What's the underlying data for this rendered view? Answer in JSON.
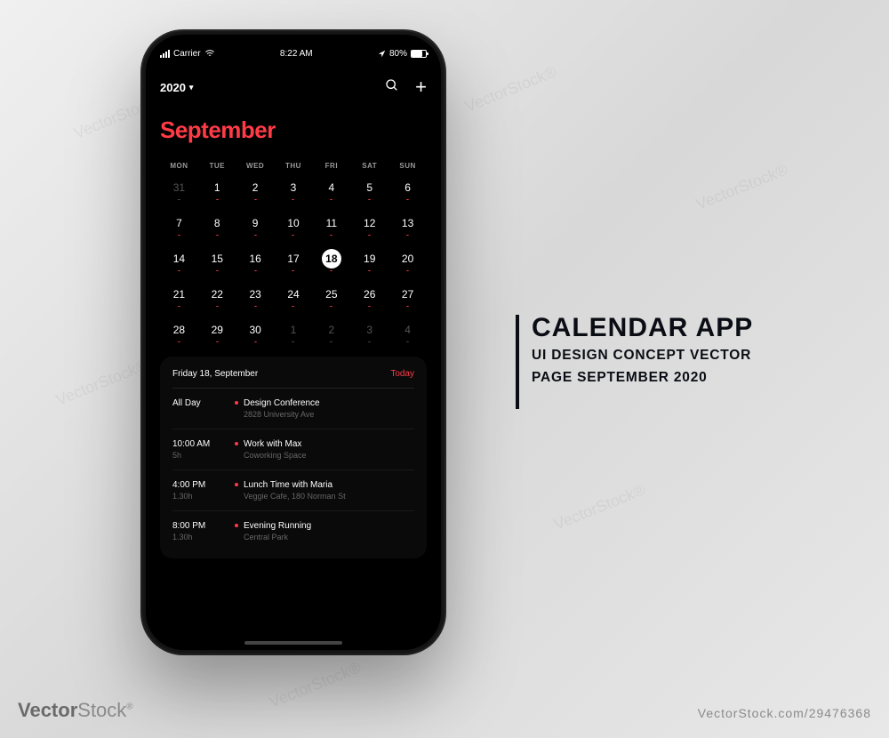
{
  "status_bar": {
    "carrier": "Carrier",
    "time": "8:22 AM",
    "battery_pct": "80%"
  },
  "nav": {
    "year": "2020",
    "search_label": "Search",
    "add_label": "Add"
  },
  "month_title": "September",
  "weekdays": [
    "MON",
    "TUE",
    "WED",
    "THU",
    "FRI",
    "SAT",
    "SUN"
  ],
  "grid": [
    {
      "n": "31",
      "dim": true,
      "dot": "gray"
    },
    {
      "n": "1",
      "dot": "red"
    },
    {
      "n": "2",
      "dot": "red"
    },
    {
      "n": "3",
      "dot": "red"
    },
    {
      "n": "4",
      "dot": "red"
    },
    {
      "n": "5",
      "dot": "red"
    },
    {
      "n": "6",
      "dot": "red"
    },
    {
      "n": "7",
      "dot": "red"
    },
    {
      "n": "8",
      "dot": "red"
    },
    {
      "n": "9",
      "dot": "red"
    },
    {
      "n": "10",
      "dot": "red"
    },
    {
      "n": "11",
      "dot": "red"
    },
    {
      "n": "12",
      "dot": "red"
    },
    {
      "n": "13",
      "dot": "red"
    },
    {
      "n": "14",
      "dot": "red"
    },
    {
      "n": "15",
      "dot": "red"
    },
    {
      "n": "16",
      "dot": "red"
    },
    {
      "n": "17",
      "dot": "red"
    },
    {
      "n": "18",
      "dot": "red",
      "selected": true
    },
    {
      "n": "19",
      "dot": "red"
    },
    {
      "n": "20",
      "dot": "red"
    },
    {
      "n": "21",
      "dot": "red"
    },
    {
      "n": "22",
      "dot": "red"
    },
    {
      "n": "23",
      "dot": "red"
    },
    {
      "n": "24",
      "dot": "red"
    },
    {
      "n": "25",
      "dot": "red"
    },
    {
      "n": "26",
      "dot": "red"
    },
    {
      "n": "27",
      "dot": "red"
    },
    {
      "n": "28",
      "dot": "red"
    },
    {
      "n": "29",
      "dot": "red"
    },
    {
      "n": "30",
      "dot": "red"
    },
    {
      "n": "1",
      "dim": true,
      "dot": "gray"
    },
    {
      "n": "2",
      "dim": true,
      "dot": "gray"
    },
    {
      "n": "3",
      "dim": true,
      "dot": "gray"
    },
    {
      "n": "4",
      "dim": true,
      "dot": "gray"
    }
  ],
  "agenda": {
    "date_label": "Friday 18, September",
    "today_label": "Today",
    "events": [
      {
        "time": "All Day",
        "dur": "",
        "title": "Design Conference",
        "loc": "2828 University Ave"
      },
      {
        "time": "10:00 AM",
        "dur": "5h",
        "title": "Work with Max",
        "loc": "Coworking Space"
      },
      {
        "time": "4:00 PM",
        "dur": "1.30h",
        "title": "Lunch Time with Maria",
        "loc": "Veggie Cafe, 180 Norman St"
      },
      {
        "time": "8:00 PM",
        "dur": "1.30h",
        "title": "Evening Running",
        "loc": "Central Park"
      }
    ]
  },
  "promo": {
    "title": "CALENDAR APP",
    "line1": "UI DESIGN CONCEPT VECTOR",
    "line2": "PAGE SEPTEMBER 2020"
  },
  "footer": {
    "brand_prefix": "Vector",
    "brand_suffix": "Stock",
    "image_id": "29476368"
  },
  "watermark": "VectorStock®"
}
